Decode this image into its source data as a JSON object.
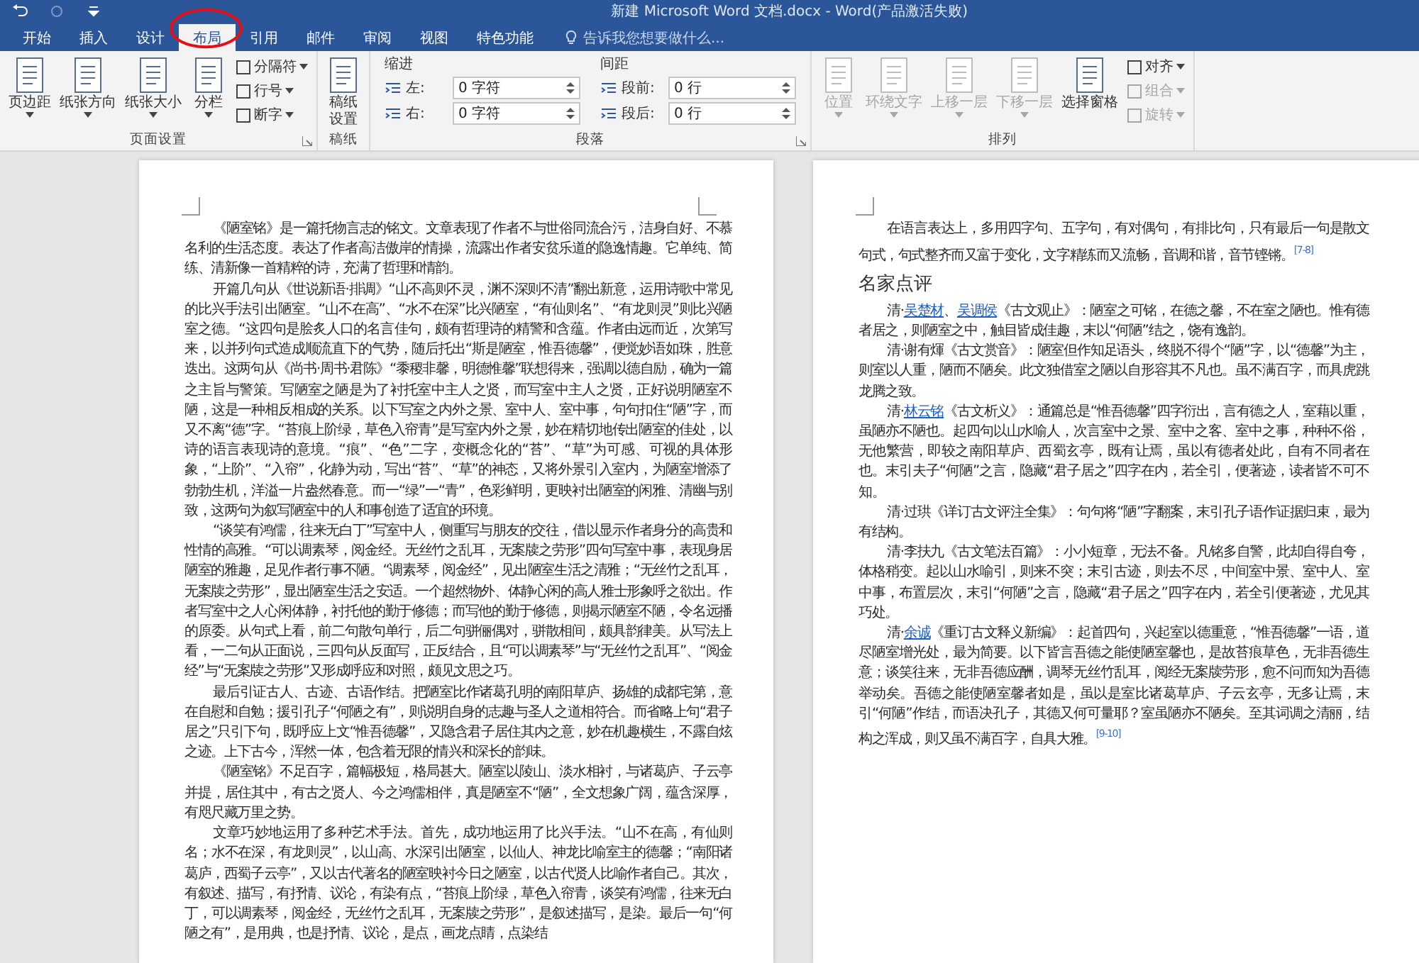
{
  "window": {
    "title": "新建 Microsoft Word 文档.docx - Word(产品激活失败)"
  },
  "tabs": [
    {
      "label": "开始",
      "selected": false
    },
    {
      "label": "插入",
      "selected": false
    },
    {
      "label": "设计",
      "selected": false
    },
    {
      "label": "布局",
      "selected": true
    },
    {
      "label": "引用",
      "selected": false
    },
    {
      "label": "邮件",
      "selected": false
    },
    {
      "label": "审阅",
      "selected": false
    },
    {
      "label": "视图",
      "selected": false
    },
    {
      "label": "特色功能",
      "selected": false
    }
  ],
  "tell_me": {
    "placeholder": "告诉我您想要做什么..."
  },
  "ribbon": {
    "groups": [
      {
        "kind": "buttons",
        "label": "页面设置",
        "launcher": true,
        "items": [
          {
            "kind": "large",
            "label": "页边距",
            "dropdown": true,
            "disabled": false
          },
          {
            "kind": "large",
            "label": "纸张方向",
            "dropdown": true,
            "disabled": false
          },
          {
            "kind": "large",
            "label": "纸张大小",
            "dropdown": true,
            "disabled": false
          },
          {
            "kind": "large",
            "label": "分栏",
            "dropdown": true,
            "disabled": false
          },
          {
            "kind": "small",
            "label": "分隔符",
            "dropdown": true,
            "disabled": false
          },
          {
            "kind": "small",
            "label": "行号",
            "dropdown": true,
            "disabled": false
          },
          {
            "kind": "small",
            "label": "断字",
            "dropdown": true,
            "disabled": false
          }
        ]
      },
      {
        "kind": "buttons",
        "label": "稿纸",
        "launcher": false,
        "items": [
          {
            "kind": "large",
            "label": "稿纸设置",
            "dropdown": false,
            "disabled": false,
            "wrapped": true
          }
        ]
      },
      {
        "kind": "spacing",
        "label": "段落",
        "launcher": true,
        "columns": [
          {
            "heading": "缩进",
            "fields": [
              {
                "label": "左:",
                "value": "0 字符"
              },
              {
                "label": "右:",
                "value": "0 字符"
              }
            ]
          },
          {
            "heading": "间距",
            "fields": [
              {
                "label": "段前:",
                "value": "0 行"
              },
              {
                "label": "段后:",
                "value": "0 行"
              }
            ]
          }
        ]
      },
      {
        "kind": "buttons",
        "label": "排列",
        "launcher": false,
        "items": [
          {
            "kind": "large",
            "label": "位置",
            "dropdown": true,
            "disabled": true
          },
          {
            "kind": "large",
            "label": "环绕文字",
            "dropdown": true,
            "disabled": true
          },
          {
            "kind": "large",
            "label": "上移一层",
            "dropdown": true,
            "disabled": true
          },
          {
            "kind": "large",
            "label": "下移一层",
            "dropdown": true,
            "disabled": true
          },
          {
            "kind": "large",
            "label": "选择窗格",
            "dropdown": false,
            "disabled": false
          },
          {
            "kind": "small",
            "label": "对齐",
            "dropdown": true,
            "disabled": false
          },
          {
            "kind": "small",
            "label": "组合",
            "dropdown": true,
            "disabled": true
          },
          {
            "kind": "small",
            "label": "旋转",
            "dropdown": true,
            "disabled": true
          }
        ]
      }
    ]
  },
  "pages": [
    {
      "blocks": [
        {
          "kind": "paragraph",
          "runs": [
            {
              "text": "《陋室铭》是一篇托物言志的铭文。文章表现了作者不与世俗同流合污，洁身自好、不慕名利的生活态度。表达了作者高洁傲岸的情操，流露出作者安贫乐道的隐逸情趣。它单纯、简练、清新像一首精粹的诗，充满了哲理和情韵。",
              "link": false
            }
          ]
        },
        {
          "kind": "paragraph",
          "runs": [
            {
              "text": "开篇几句从《世说新语·排调》“山不高则不灵，渊不深则不清”翻出新意，运用诗歌中常见的比兴手法引出陋室。“山不在高”、“水不在深”比兴陋室，“有仙则名”、“有龙则灵”则比兴陋室之德。“这四句是脍炙人口的名言佳句，颇有哲理诗的精警和含蕴。作者由远而近，次第写来，以并列句式造成顺流直下的气势，随后托出“斯是陋室，惟吾德馨”，便觉妙语如珠，胜意迭出。这两句从《尚书·周书·君陈》“黍稷非馨，明德惟馨”联想得来，强调以德自励，确为一篇之主旨与警策。写陋室之陋是为了衬托室中主人之贤，而写室中主人之贤，正好说明陋室不陋，这是一种相反相成的关系。以下写室之内外之景、室中人、室中事，句句扣住“陋”字，而又不离“德”字。“苔痕上阶绿，草色入帘青”是写室内外之景，妙在精切地传出陋室的佳处，以诗的语言表现诗的意境。“痕”、“色”二字，变概念化的“苔”、“草”为可感、可视的具体形象，“上阶”、“入帘”，化静为动，写出“苔”、“草”的神态，又将外景引入室内，为陋室增添了勃勃生机，洋溢一片盎然春意。而一“绿”一“青”，色彩鲜明，更映衬出陋室的闲雅、清幽与别致，这两句为叙写陋室中的人和事创造了适宜的环境。",
              "link": false
            }
          ]
        },
        {
          "kind": "paragraph",
          "runs": [
            {
              "text": "“谈笑有鸿儒，往来无白丁”写室中人，侧重写与朋友的交往，借以显示作者身分的高贵和性情的高雅。“可以调素琴，阅金经。无丝竹之乱耳，无案牍之劳形”四句写室中事，表现身居陋室的雅趣，足见作者行事不陋。“调素琴，阅金经”，见出陋室生活之清雅；“无丝竹之乱耳，无案牍之劳形”，显出陋室生活之安适。一个超然物外、体静心闲的高人雅士形象呼之欲出。作者写室中之人心闲体静，衬托他的勤于修德；而写他的勤于修德，则揭示陋室不陋，令名远播的原委。从句式上看，前二句散句单行，后二句骈俪偶对，骈散相间，颇具韵律美。从写法上看，一二句从正面说，三四句从反面写，正反结合，且“可以调素琴”与“无丝竹之乱耳”、“阅金经”与“无案牍之劳形”又形成呼应和对照，颇见文思之巧。",
              "link": false
            }
          ]
        },
        {
          "kind": "paragraph",
          "runs": [
            {
              "text": "最后引证古人、古迹、古语作结。把陋室比作诸葛孔明的南阳草庐、扬雄的成都宅第，意在自慰和自勉；援引孔子“何陋之有”，则说明自身的志趣与圣人之道相符合。而省略上句“君子居之”只引下句，既呼应上文“惟吾德馨”，又隐含君子居住其内之意，妙在机趣横生，不露自炫之迹。上下古今，浑然一体，包含着无限的情兴和深长的韵味。",
              "link": false
            }
          ]
        },
        {
          "kind": "paragraph",
          "runs": [
            {
              "text": "《陋室铭》不足百字，篇幅极短，格局甚大。陋室以陵山、淡水相衬，与诸葛庐、子云亭并提，居住其中，有古之贤人、今之鸿儒相伴，真是陋室不“陋”，全文想象广阔，蕴含深厚，有咫尺藏万里之势。",
              "link": false
            }
          ]
        },
        {
          "kind": "paragraph",
          "runs": [
            {
              "text": "文章巧妙地运用了多种艺术手法。首先，成功地运用了比兴手法。“山不在高，有仙则名；水不在深，有龙则灵”，以山高、水深引出陋室，以仙人、神龙比喻室主的德馨；“南阳诸葛庐，西蜀子云亭”，又以古代著名的陋室映衬今日之陋室，以古代贤人比喻作者自己。其次，有叙述、描写，有抒情、议论，有染有点，“苔痕上阶绿，草色入帘青，谈笑有鸿儒，往来无白丁，可以调素琴，阅金经，无丝竹之乱耳，无案牍之劳形”，是叙述描写，是染。最后一句“何陋之有”，是用典，也是抒情、议论，是点，画龙点睛，点染结",
              "link": false
            }
          ]
        }
      ]
    },
    {
      "blocks": [
        {
          "kind": "paragraph",
          "runs": [
            {
              "text": "在语言表达上，多用四字句、五字句，有对偶句，有排比句，只有最后一句是散文句式，句式整齐而又富于变化，文字精练而又流畅，音调和谐，音节铿锵。$^{[7-8]}$",
              "link": false
            }
          ]
        },
        {
          "kind": "heading",
          "runs": [
            {
              "text": "名家点评",
              "link": false
            }
          ]
        },
        {
          "kind": "paragraph",
          "runs": [
            {
              "text": "清·",
              "link": false
            },
            {
              "text": "吴楚材",
              "link": true
            },
            {
              "text": "、",
              "link": false
            },
            {
              "text": "吴调侯",
              "link": true
            },
            {
              "text": "《古文观止》：陋室之可铭，在德之馨，不在室之陋也。惟有德者居之，则陋室之中，触目皆成佳趣，末以“何陋”结之，饶有逸韵。",
              "link": false
            }
          ]
        },
        {
          "kind": "paragraph",
          "runs": [
            {
              "text": "清·谢有煇《古文赏音》：陋室但作知足语头，终脱不得个“陋”字，以“德馨”为主，则室以人重，陋而不陋矣。此文独借室之陋以自形容其不凡也。虽不满百字，而具虎跳龙腾之致。",
              "link": false
            }
          ]
        },
        {
          "kind": "paragraph",
          "runs": [
            {
              "text": "清·",
              "link": false
            },
            {
              "text": "林云铭",
              "link": true
            },
            {
              "text": "《古文析义》：通篇总是“惟吾德馨”四字衍出，言有德之人，室藉以重，虽陋亦不陋也。起四句以山水喻人，次言室中之景、室中之客、室中之事，种种不俗，无他繁营，即较之南阳草庐、西蜀玄亭，既有让焉，虽以有德者处此，自有不同者在也。末引夫子“何陋”之言，隐藏“君子居之”四字在内，若全引，便著迹，读者皆不可不知。",
              "link": false
            }
          ]
        },
        {
          "kind": "paragraph",
          "runs": [
            {
              "text": "清·过珙《详订古文评注全集》：句句将“陋”字翻案，末引孔子语作证据归束，最为有结构。",
              "link": false
            }
          ]
        },
        {
          "kind": "paragraph",
          "runs": [
            {
              "text": "清·李扶九《古文笔法百篇》：小小短章，无法不备。凡铭多自警，此却自得自夸，体格稍变。起以山水喻引，则来不突；末引古迹，则去不尽，中间室中景、室中人、室中事，布置层次，末引“何陋”之言，隐藏“君子居之”四字在内，若全引便著迹，尤见其巧处。",
              "link": false
            }
          ]
        },
        {
          "kind": "paragraph",
          "runs": [
            {
              "text": "清·",
              "link": false
            },
            {
              "text": "余诚",
              "link": true
            },
            {
              "text": "《重订古文释义新编》：起首四句，兴起室以德重意，“惟吾德馨”一语，道尽陋室增光处，最为简要。以下皆言吾德之能使陋室馨也，是故苔痕草色，无非吾德生意；谈笑往来，无非吾德应酬，调琴无丝竹乱耳，阅经无案牍劳形，愈不问而知为吾德举动矣。吾德之能使陋室馨者如是，虽以是室比诸葛草庐、子云玄亭，无多让焉，末引“何陋”作结，而语决孔子，其德又何可量耶？室虽陋亦不陋矣。至其词调之清丽，结构之浑成，则又虽不满百字，自具大雅。$^{[9-10]}$",
              "link": false
            }
          ]
        }
      ]
    }
  ]
}
